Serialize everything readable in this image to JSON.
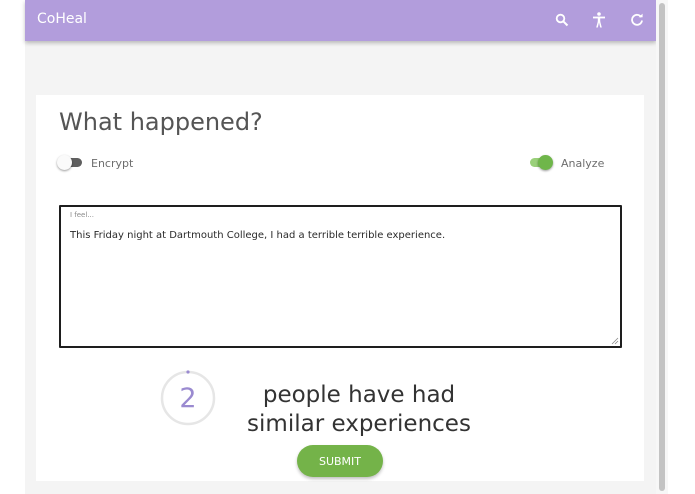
{
  "appbar": {
    "brand": "CoHeal",
    "icons": [
      "search-icon",
      "accessibility-icon",
      "refresh-icon"
    ],
    "color": "#b29ddc"
  },
  "card": {
    "title": "What happened?",
    "toggles": {
      "encrypt": {
        "label": "Encrypt",
        "on": false
      },
      "analyze": {
        "label": "Analyze",
        "on": true
      }
    },
    "textarea": {
      "label": "I feel...",
      "value": "This Friday night at Dartmouth College, I had a terrible terrible experience."
    },
    "similar": {
      "count": "2",
      "text": "people have had similar experiences"
    },
    "submit_label": "SUBMIT"
  },
  "colors": {
    "accent": "#b29ddc",
    "success": "#74b349",
    "counter_text": "#9a8ad0"
  }
}
